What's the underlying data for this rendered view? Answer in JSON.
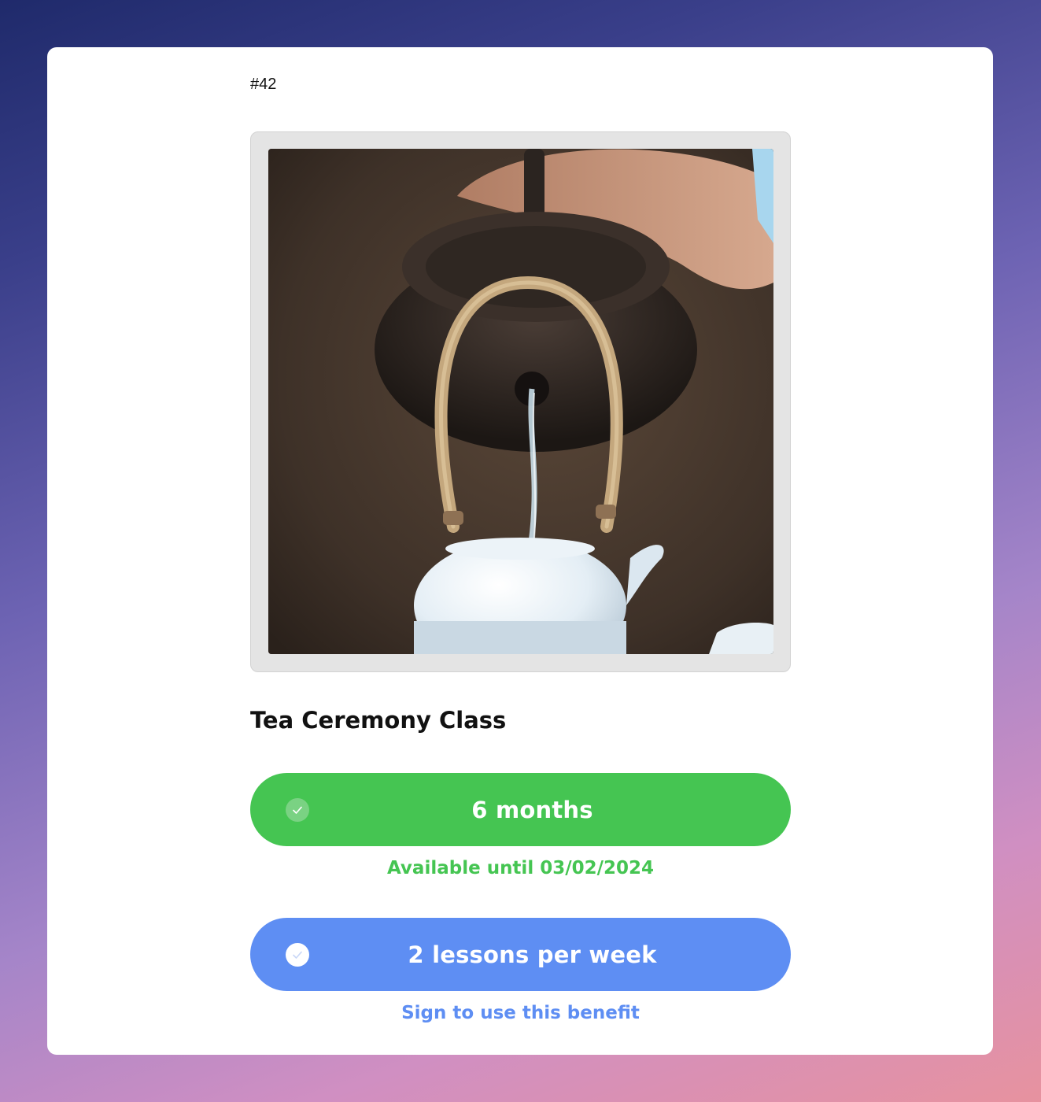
{
  "card": {
    "token_id": "#42",
    "image": {
      "alt": "Tea Ceremony Class"
    },
    "title": "Tea Ceremony Class"
  },
  "benefits": [
    {
      "label": "6 months",
      "status_text": "Available until 03/02/2024",
      "color": "#45c552",
      "icon": "check-icon"
    },
    {
      "label": "2 lessons per week",
      "status_text": "Sign to use this benefit",
      "color": "#5e8ef3",
      "icon": "check-icon"
    }
  ]
}
